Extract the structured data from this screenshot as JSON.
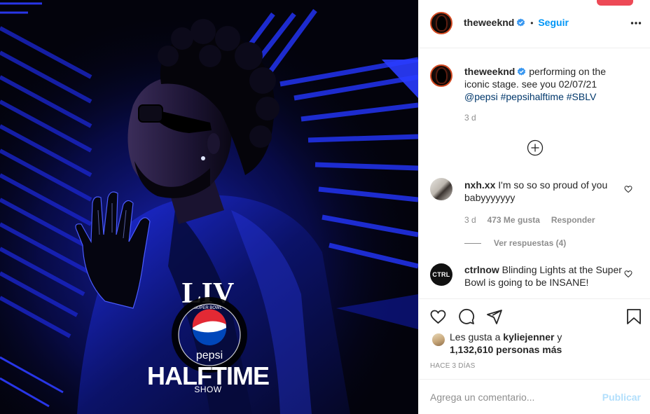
{
  "post": {
    "media_caption_lines": {
      "liv": "LIV",
      "super_bowl": "SUPER BOWL",
      "pepsi": "pepsi",
      "halftime": "HALFTIME",
      "show": "SHOW"
    }
  },
  "header": {
    "username": "theweeknd",
    "separator": "•",
    "follow_label": "Seguir",
    "more_icon": "more-horizontal-icon"
  },
  "caption": {
    "username": "theweeknd",
    "text_part1": "performing on the iconic stage. see you 02/07/21 ",
    "mention": "@pepsi",
    "hashtag1": "#pepsihalftime",
    "hashtag2": "#SBLV",
    "age": "3 d"
  },
  "load_more_icon": "plus-circle-icon",
  "comments": [
    {
      "username": "nxh.xx",
      "text": "I'm so so so proud of you babyyyyyyy",
      "age": "3 d",
      "likes": "473 Me gusta",
      "reply_label": "Responder",
      "view_replies": "Ver respuestas (4)"
    },
    {
      "username": "ctrlnow",
      "avatar_text": "CTRL",
      "text": "Blinding Lights at the Super Bowl is going to be INSANE!"
    }
  ],
  "actions": {
    "like_icon": "heart-icon",
    "comment_icon": "comment-icon",
    "share_icon": "send-icon",
    "save_icon": "bookmark-icon"
  },
  "likes": {
    "prefix": "Les gusta a ",
    "user": "kyliejenner",
    "middle": " y",
    "count": "1,132,610 personas más"
  },
  "time_ago": "HACE 3 DÍAS",
  "comment_input": {
    "placeholder": "Agrega un comentario...",
    "publish_label": "Publicar"
  },
  "colors": {
    "accent": "#0095f6",
    "publish_disabled": "#b2dffc",
    "link": "#00376b",
    "muted": "#8e8e8e",
    "notification": "#ed4956"
  }
}
